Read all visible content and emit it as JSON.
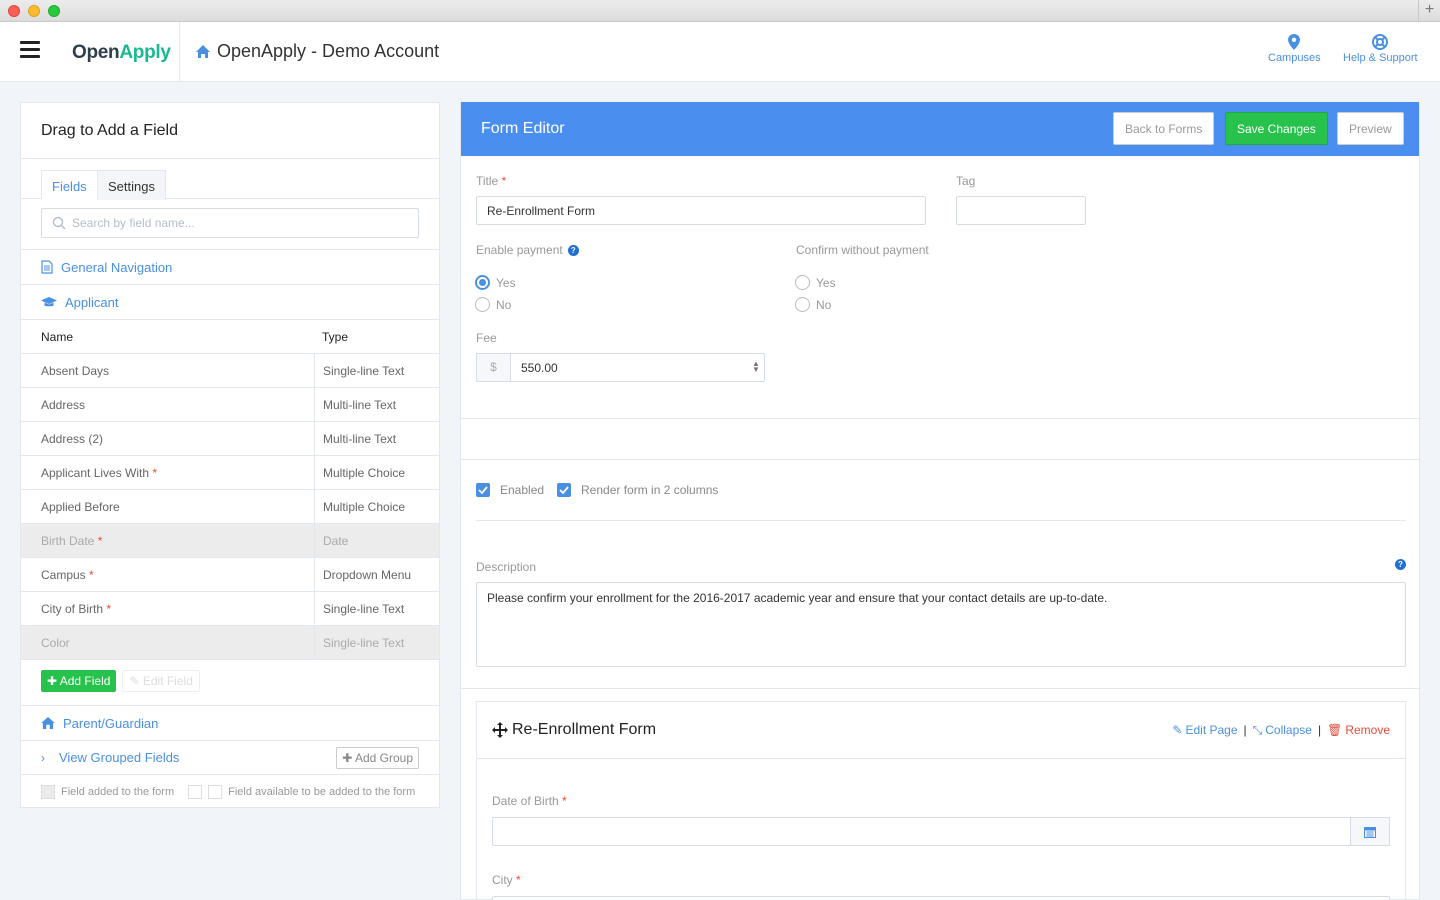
{
  "header": {
    "logo_open": "Open",
    "logo_apply": "Apply",
    "account": "OpenApply - Demo Account",
    "links": {
      "campuses": "Campuses",
      "help": "Help & Support"
    }
  },
  "left": {
    "title": "Drag to Add a Field",
    "tabs": {
      "fields": "Fields",
      "settings": "Settings"
    },
    "search_placeholder": "Search by field name...",
    "general_navigation": "General Navigation",
    "applicant": "Applicant",
    "table": {
      "col_name": "Name",
      "col_type": "Type",
      "rows": [
        {
          "name": "Absent Days",
          "required": "",
          "type": "Single-line Text"
        },
        {
          "name": "Address",
          "required": "",
          "type": "Multi-line Text"
        },
        {
          "name": "Address (2)",
          "required": "",
          "type": "Multi-line Text"
        },
        {
          "name": "Applicant Lives With",
          "required": "*",
          "type": "Multiple Choice"
        },
        {
          "name": "Applied Before",
          "required": "",
          "type": "Multiple Choice"
        },
        {
          "name": "Birth Date",
          "required": "*",
          "type": "Date"
        },
        {
          "name": "Campus",
          "required": "*",
          "type": "Dropdown Menu"
        },
        {
          "name": "City of Birth",
          "required": "*",
          "type": "Single-line Text"
        },
        {
          "name": "Color",
          "required": "",
          "type": "Single-line Text"
        }
      ]
    },
    "add_field": "Add Field",
    "edit_field": "Edit Field",
    "parent_guardian": "Parent/Guardian",
    "view_grouped": "View Grouped Fields",
    "add_group": "Add Group",
    "legend_added": "Field added to the form",
    "legend_available": "Field available to be added to the form"
  },
  "editor": {
    "title": "Form Editor",
    "back": "Back to Forms",
    "save": "Save Changes",
    "preview": "Preview",
    "title_label": "Title",
    "title_value": "Re-Enrollment Form",
    "tag_label": "Tag",
    "tag_value": "",
    "enable_payment": "Enable payment",
    "confirm_without_payment": "Confirm without payment",
    "yes": "Yes",
    "no": "No",
    "fee_label": "Fee",
    "fee_currency": "$",
    "fee_value": "550.00",
    "enabled": "Enabled",
    "two_columns": "Render form in 2 columns",
    "description_label": "Description",
    "description_value": "Please confirm your enrollment for the 2016-2017 academic year and ensure that your contact details are up-to-date.",
    "page": {
      "title": "Re-Enrollment Form",
      "edit_page": "Edit Page",
      "collapse": "Collapse",
      "remove": "Remove",
      "date_of_birth": "Date of Birth",
      "city": "City",
      "required_mark": "*"
    }
  },
  "colors": {
    "accent": "#4a90e2",
    "header_bar": "#4a8ff0",
    "success": "#27c24c",
    "danger": "#e74c3c",
    "brand_green": "#19b993"
  }
}
